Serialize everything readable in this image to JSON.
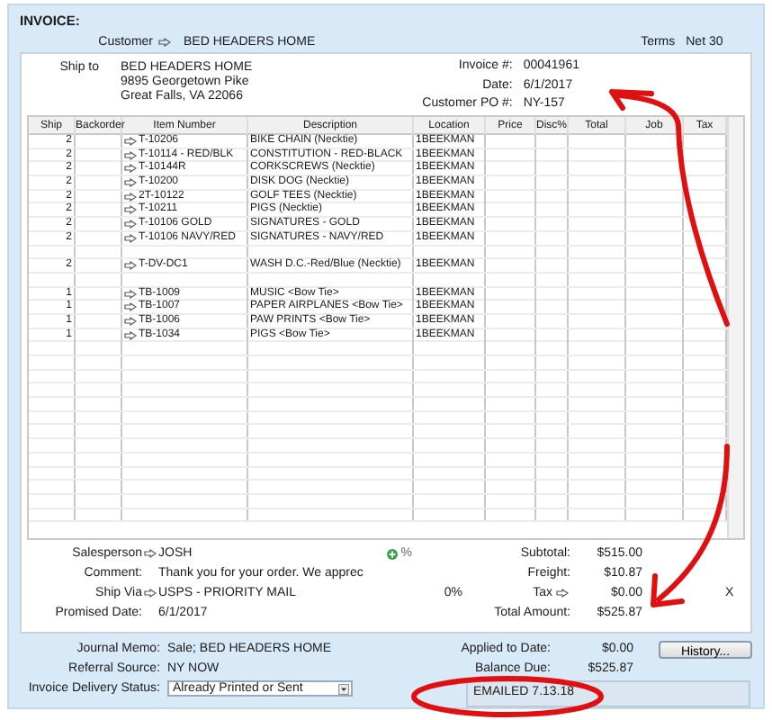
{
  "title": "INVOICE:",
  "customer": {
    "label": "Customer",
    "value": "BED HEADERS HOME"
  },
  "terms": {
    "label": "Terms",
    "value": "Net 30"
  },
  "ship_to": {
    "label": "Ship to",
    "lines": [
      "BED HEADERS HOME",
      "9895 Georgetown Pike",
      "Great Falls, VA 22066"
    ]
  },
  "invoice_fields": [
    {
      "label": "Invoice #:",
      "value": "00041961"
    },
    {
      "label": "Date:",
      "value": "6/1/2017"
    },
    {
      "label": "Customer PO #:",
      "value": "NY-157"
    }
  ],
  "table": {
    "columns": [
      "Ship",
      "Backorder",
      "Item Number",
      "Description",
      "Location",
      "Price",
      "Disc%",
      "Total",
      "Job",
      "Tax"
    ],
    "rows": [
      {
        "kind": "item",
        "ship": "2",
        "item_number": "T-10206",
        "description": "BIKE CHAIN (Necktie)",
        "location": "1BEEKMAN"
      },
      {
        "kind": "item",
        "ship": "2",
        "item_number": "T-10114 - RED/BLK",
        "description": "CONSTITUTION - RED-BLACK",
        "location": "1BEEKMAN"
      },
      {
        "kind": "item",
        "ship": "2",
        "item_number": "T-10144R",
        "description": "CORKSCREWS (Necktie)",
        "location": "1BEEKMAN"
      },
      {
        "kind": "item",
        "ship": "2",
        "item_number": "T-10200",
        "description": "DISK DOG (Necktie)",
        "location": "1BEEKMAN"
      },
      {
        "kind": "item",
        "ship": "2",
        "item_number": "2T-10122",
        "description": "GOLF TEES (Necktie)",
        "location": "1BEEKMAN"
      },
      {
        "kind": "item",
        "ship": "2",
        "item_number": "T-10211",
        "description": "PIGS (Necktie)",
        "location": "1BEEKMAN"
      },
      {
        "kind": "item",
        "ship": "2",
        "item_number": "T-10106 GOLD",
        "description": "SIGNATURES - GOLD",
        "location": "1BEEKMAN"
      },
      {
        "kind": "item",
        "ship": "2",
        "item_number": "T-10106 NAVY/RED",
        "description": "SIGNATURES - NAVY/RED",
        "location": "1BEEKMAN"
      },
      {
        "kind": "blank"
      },
      {
        "kind": "item",
        "ship": "2",
        "item_number": "T-DV-DC1",
        "description": "WASH D.C.-Red/Blue (Necktie)",
        "location": "1BEEKMAN"
      },
      {
        "kind": "blank"
      },
      {
        "kind": "item",
        "ship": "1",
        "item_number": "TB-1009",
        "description": "MUSIC <Bow Tie>",
        "location": "1BEEKMAN"
      },
      {
        "kind": "item",
        "ship": "1",
        "item_number": "TB-1007",
        "description": "PAPER AIRPLANES <Bow Tie>",
        "location": "1BEEKMAN"
      },
      {
        "kind": "item",
        "ship": "1",
        "item_number": "TB-1006",
        "description": "PAW PRINTS <Bow Tie>",
        "location": "1BEEKMAN"
      },
      {
        "kind": "item",
        "ship": "1",
        "item_number": "TB-1034",
        "description": "PIGS <Bow Tie>",
        "location": "1BEEKMAN"
      }
    ]
  },
  "footer_left": [
    {
      "label": "Salesperson",
      "arrow": true,
      "value": "JOSH"
    },
    {
      "label": "Comment:",
      "arrow": false,
      "value": "Thank you for your order. We apprec"
    },
    {
      "label": "Ship Via",
      "arrow": true,
      "value": "USPS - PRIORITY MAIL"
    },
    {
      "label": "Promised Date:",
      "arrow": false,
      "value": "6/1/2017"
    }
  ],
  "percent_label": "%",
  "totals": [
    {
      "label": "Subtotal:",
      "value": "$515.00"
    },
    {
      "label": "Freight:",
      "value": "$10.87"
    },
    {
      "label": "Tax",
      "prefix": "0%",
      "value": "$0.00",
      "flag": "X"
    },
    {
      "label": "Total Amount:",
      "value": "$525.87"
    }
  ],
  "bottom_left": [
    {
      "label": "Journal Memo:",
      "value": "Sale; BED HEADERS HOME"
    },
    {
      "label": "Referral Source:",
      "value": "NY NOW"
    }
  ],
  "delivery_status": {
    "label": "Invoice Delivery Status:",
    "value": "Already Printed or Sent"
  },
  "bottom_right": [
    {
      "label": "Applied to Date:",
      "value": "$0.00"
    },
    {
      "label": "Balance Due:",
      "value": "$525.87"
    }
  ],
  "history_button": "History...",
  "note": "EMAILED 7.13.18"
}
